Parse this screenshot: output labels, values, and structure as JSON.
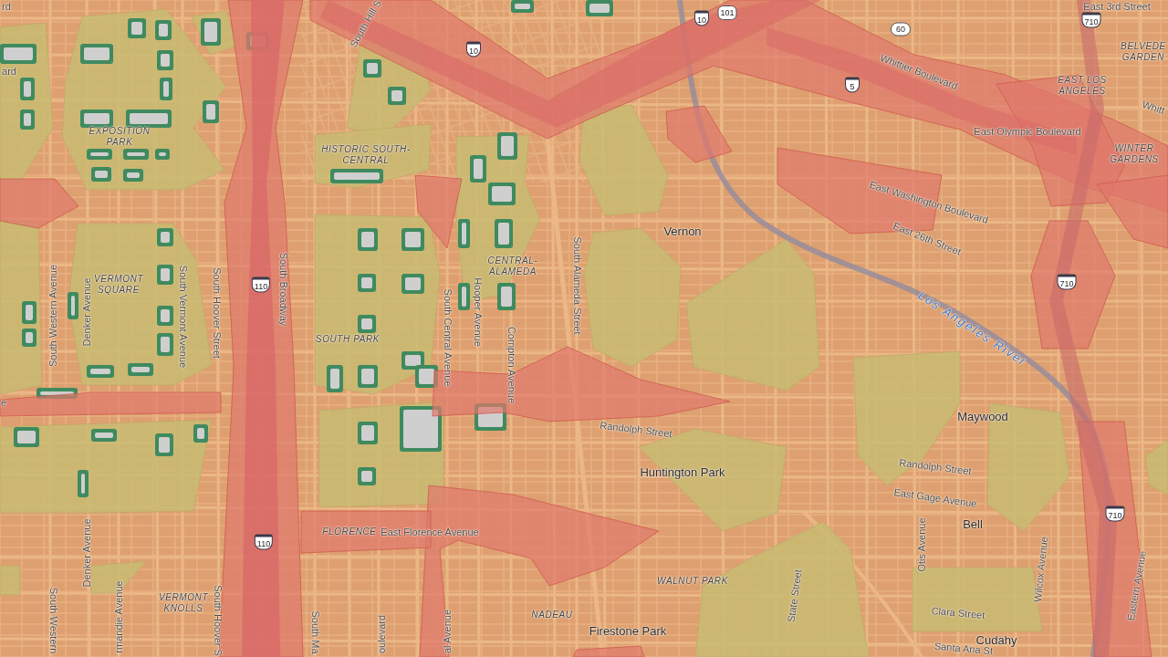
{
  "map": {
    "labels": [
      {
        "kind": "street",
        "text": "rd"
      },
      {
        "kind": "street",
        "text": "South Hill S"
      },
      {
        "kind": "street",
        "text": "East 3rd Street"
      },
      {
        "kind": "district",
        "lines": [
          "BELVEDE",
          "GARDEN"
        ]
      },
      {
        "kind": "street",
        "text": "Whittier Boulevard"
      },
      {
        "kind": "street",
        "text": "ard"
      },
      {
        "kind": "district",
        "lines": [
          "EAST LOS",
          "ANGELES"
        ]
      },
      {
        "kind": "street",
        "text": "Whitt"
      },
      {
        "kind": "district",
        "lines": [
          "EXPOSITION",
          "PARK"
        ]
      },
      {
        "kind": "street",
        "text": "East Olympic Boulevard"
      },
      {
        "kind": "district",
        "lines": [
          "HISTORIC SOUTH-",
          "CENTRAL"
        ]
      },
      {
        "kind": "district",
        "lines": [
          "WINTER",
          "GARDENS"
        ]
      },
      {
        "kind": "street",
        "text": "East Washington Boulevard"
      },
      {
        "kind": "city",
        "text": "Vernon"
      },
      {
        "kind": "street",
        "text": "East 26th Street"
      },
      {
        "kind": "district",
        "lines": [
          "CENTRAL-",
          "ALAMEDA"
        ]
      },
      {
        "kind": "street",
        "text": "South Western Avenue"
      },
      {
        "kind": "street",
        "text": "Denker Avenue"
      },
      {
        "kind": "district",
        "lines": [
          "VERMONT",
          "SQUARE"
        ]
      },
      {
        "kind": "street",
        "text": "South Vermont Avenue"
      },
      {
        "kind": "street",
        "text": "South Hoover Street"
      },
      {
        "kind": "street",
        "text": "South Broadway"
      },
      {
        "kind": "street",
        "text": "Hooper Avenue"
      },
      {
        "kind": "street",
        "text": "South Alameda Street"
      },
      {
        "kind": "water",
        "text": "Los Angeles River"
      },
      {
        "kind": "street",
        "text": "South Central Avenue"
      },
      {
        "kind": "district",
        "lines": [
          "SOUTH PARK"
        ]
      },
      {
        "kind": "street",
        "text": "Compton Avenue"
      },
      {
        "kind": "street",
        "text": "e"
      },
      {
        "kind": "city",
        "text": "Maywood"
      },
      {
        "kind": "street",
        "text": "Randolph Street"
      },
      {
        "kind": "street",
        "text": "Randolph Street"
      },
      {
        "kind": "city",
        "text": "Huntington Park"
      },
      {
        "kind": "street",
        "text": "East Gage Avenue"
      },
      {
        "kind": "city",
        "text": "Bell"
      },
      {
        "kind": "district",
        "lines": [
          "FLORENCE"
        ]
      },
      {
        "kind": "street",
        "text": "East Florence Avenue"
      },
      {
        "kind": "street",
        "text": "Otis Avenue"
      },
      {
        "kind": "street",
        "text": "Denker Avenue"
      },
      {
        "kind": "street",
        "text": "Wilcox Avenue"
      },
      {
        "kind": "district",
        "lines": [
          "WALNUT PARK"
        ]
      },
      {
        "kind": "street",
        "text": "Eastern Avenue"
      },
      {
        "kind": "street",
        "text": "State Street"
      },
      {
        "kind": "district",
        "lines": [
          "VERMONT",
          "KNOLLS"
        ]
      },
      {
        "kind": "street",
        "text": "Clara Street"
      },
      {
        "kind": "district",
        "lines": [
          "NADEAU"
        ]
      },
      {
        "kind": "street",
        "text": "rmandie Avenue"
      },
      {
        "kind": "street",
        "text": "South Western"
      },
      {
        "kind": "street",
        "text": "South Hoover S"
      },
      {
        "kind": "city",
        "text": "Firestone Park"
      },
      {
        "kind": "street",
        "text": "al Avenue"
      },
      {
        "kind": "street",
        "text": "South Ma"
      },
      {
        "kind": "street",
        "text": "oulevard"
      },
      {
        "kind": "city",
        "text": "Cudahy"
      },
      {
        "kind": "street",
        "text": "Santa Ana St"
      }
    ],
    "route_shields": [
      {
        "kind": "us",
        "number": "101"
      },
      {
        "kind": "interstate",
        "number": "10"
      },
      {
        "kind": "interstate",
        "number": "710"
      },
      {
        "kind": "state",
        "number": "60"
      },
      {
        "kind": "interstate",
        "number": "10"
      },
      {
        "kind": "interstate",
        "number": "5"
      },
      {
        "kind": "interstate",
        "number": "710"
      },
      {
        "kind": "interstate",
        "number": "110"
      },
      {
        "kind": "interstate",
        "number": "710"
      },
      {
        "kind": "interstate",
        "number": "110"
      }
    ]
  }
}
